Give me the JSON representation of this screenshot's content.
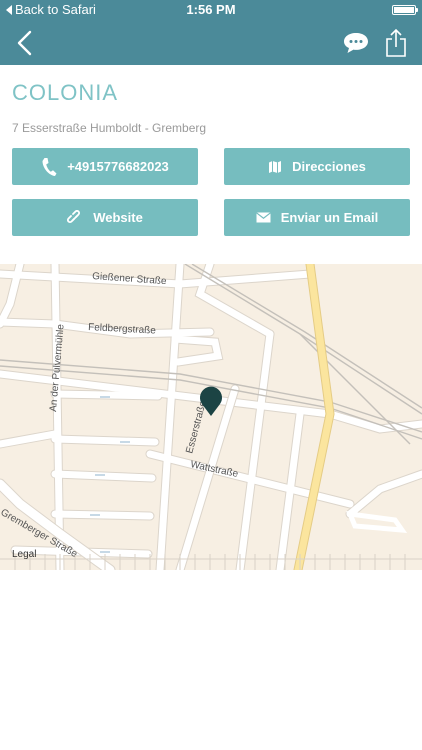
{
  "status_bar": {
    "back_label": "Back to Safari",
    "time": "1:56 PM",
    "battery_level": 1.0
  },
  "nav": {
    "back_icon": "chevron-left-icon",
    "chat_icon": "speech-bubble-icon",
    "share_icon": "share-icon",
    "accent_color": "#4b8a99"
  },
  "place": {
    "name": "COLONIA",
    "address": "7 Esserstraße Humboldt - Gremberg"
  },
  "actions": {
    "phone": {
      "label": "+4915776682023",
      "icon": "phone-icon"
    },
    "directions": {
      "label": "Direcciones",
      "icon": "map-icon"
    },
    "website": {
      "label": "Website",
      "icon": "link-icon"
    },
    "email": {
      "label": "Enviar un Email",
      "icon": "envelope-icon"
    },
    "button_color": "#76bdbf"
  },
  "map": {
    "streets": {
      "giessener": "Gießener Straße",
      "feldberg": "Feldbergstraße",
      "pulvermuehle": "An der Pulvermühle",
      "esser": "Esserstraße",
      "watt": "Wattstraße",
      "gremberger": "Gremberger Straße"
    },
    "legal_label": "Legal",
    "pin_icon": "map-pin-icon",
    "pin_color": "#1c4444"
  }
}
